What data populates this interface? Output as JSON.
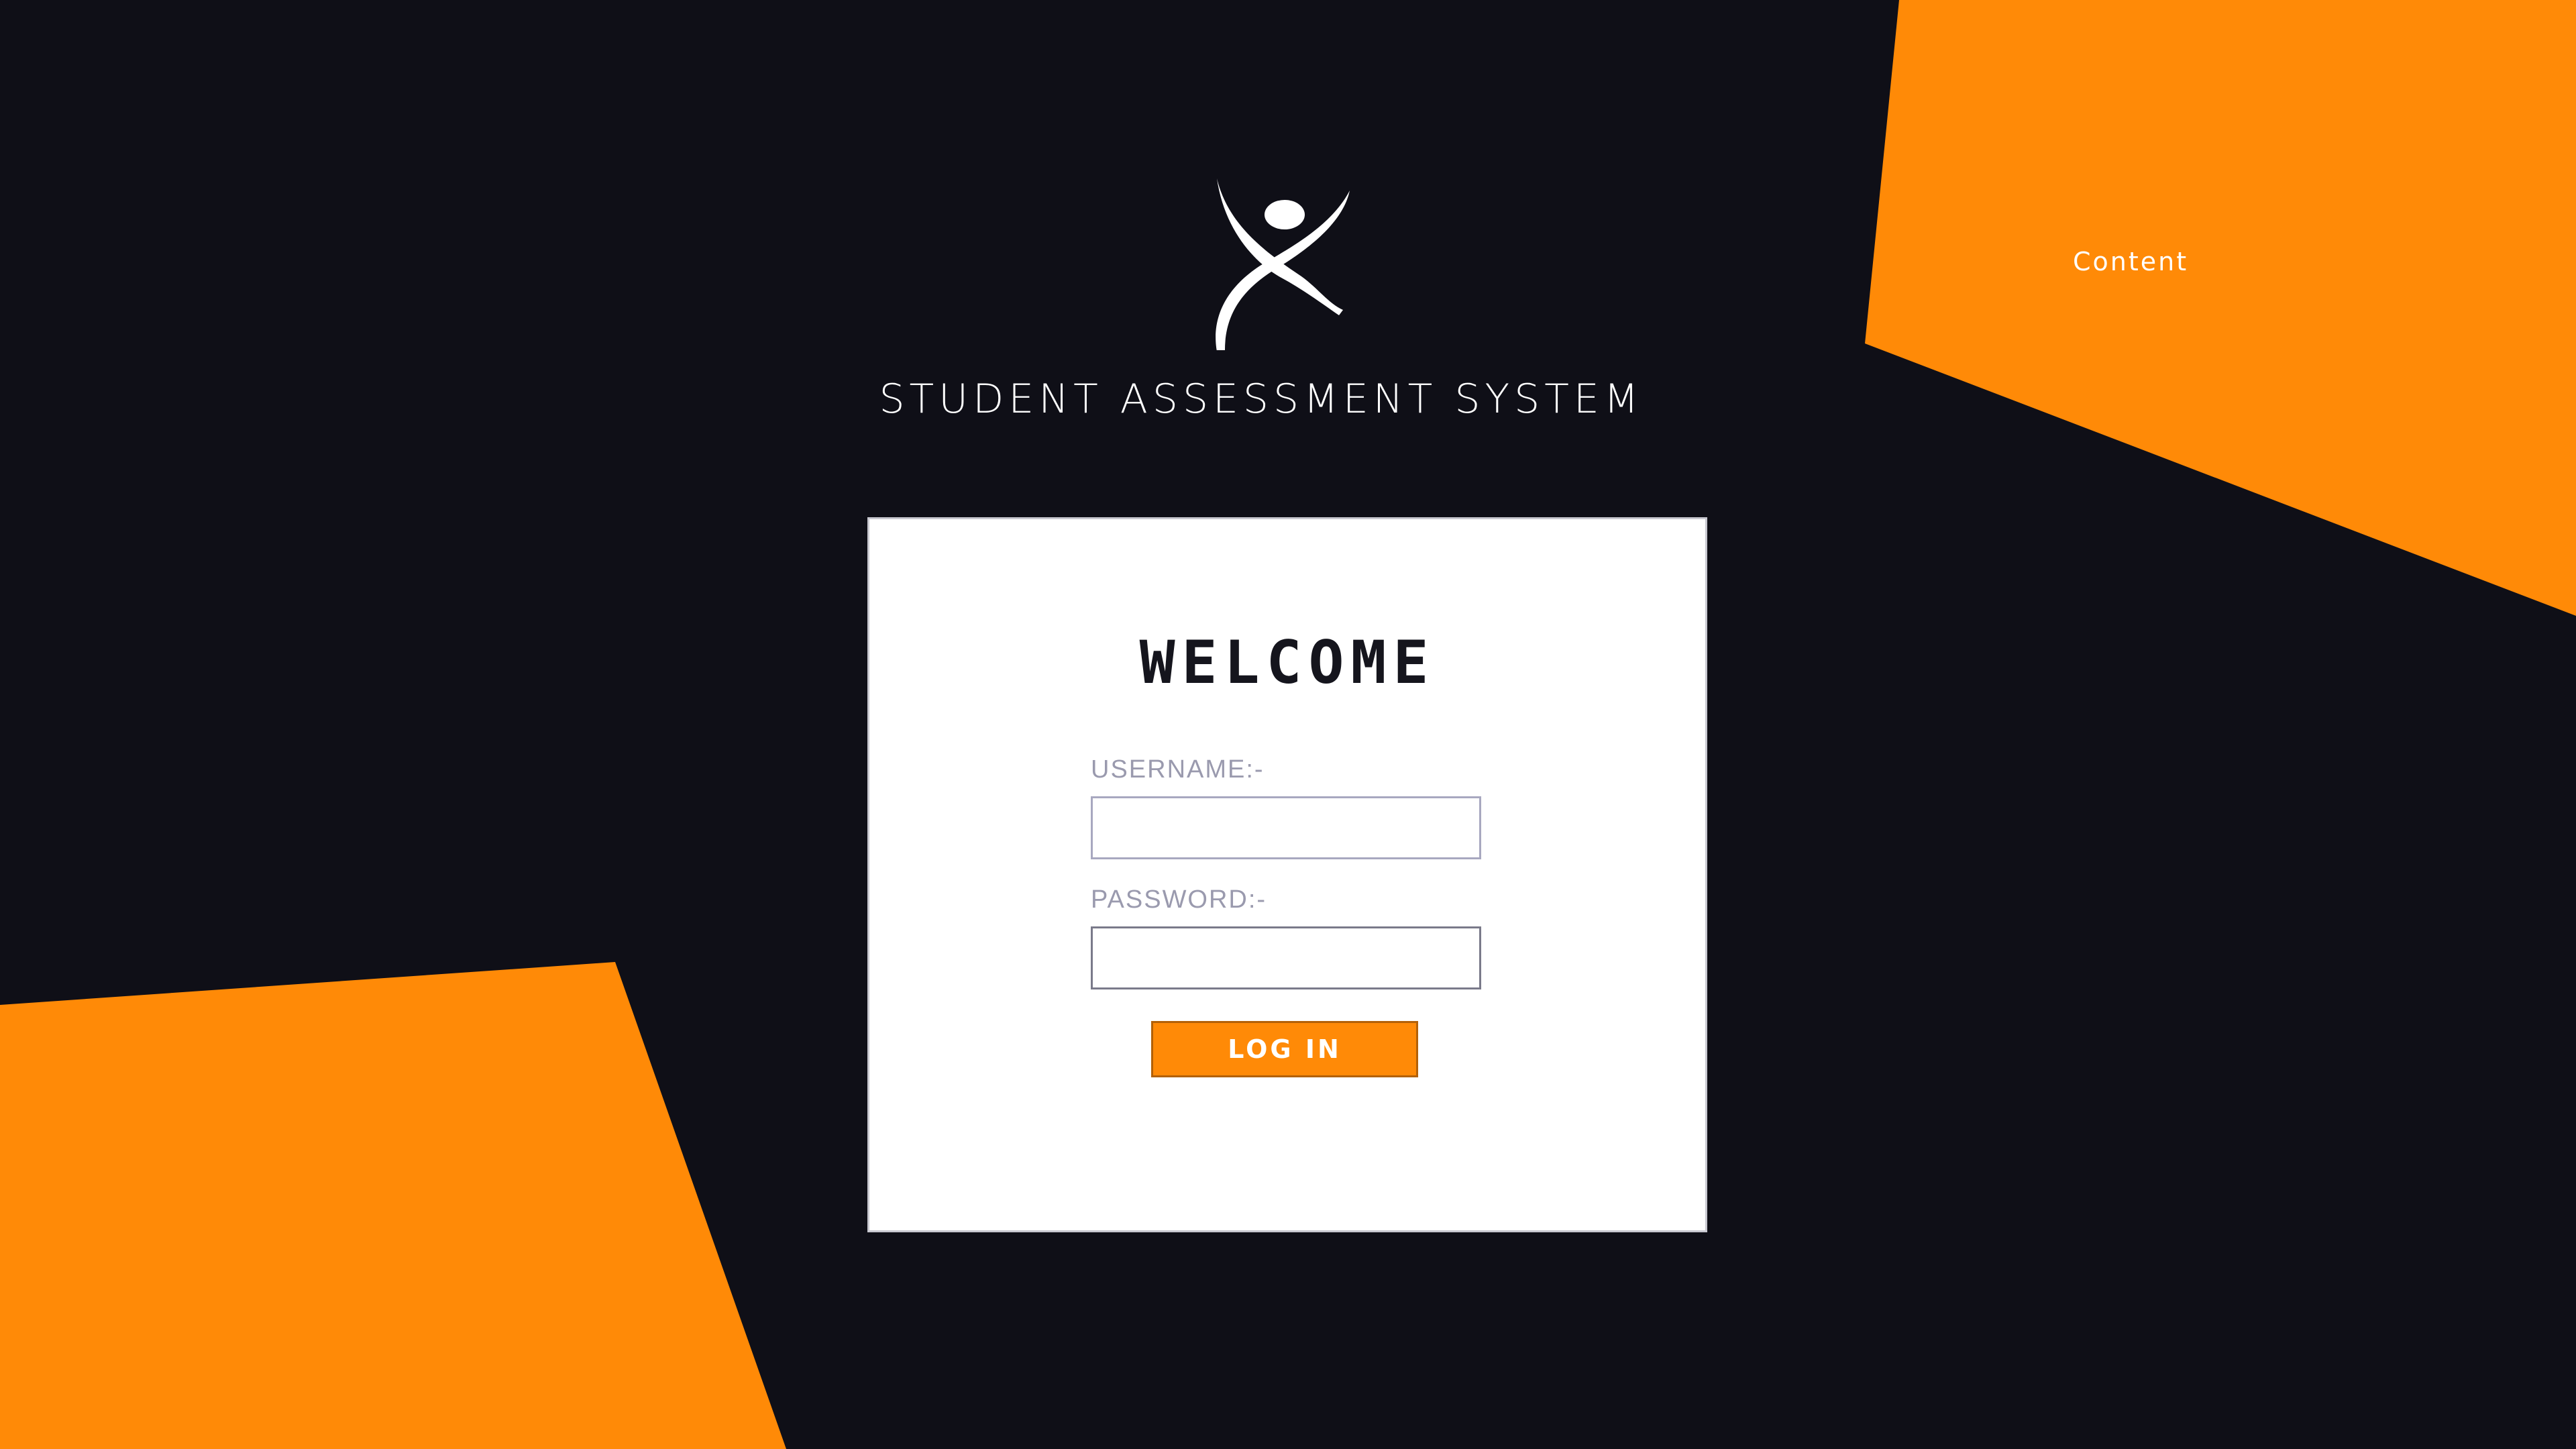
{
  "header": {
    "corner_link": "Content",
    "app_title": "STUDENT ASSESSMENT SYSTEM",
    "logo_icon": "person-jumping-logo-icon"
  },
  "login_card": {
    "heading": "WELCOME",
    "username_label": "USERNAME:-",
    "username_value": "",
    "password_label": "PASSWORD:-",
    "password_value": "",
    "login_button": "LOG IN"
  },
  "colors": {
    "background": "#0f0f17",
    "accent": "#ff8a07",
    "card": "#ffffff",
    "label": "#9a9aae"
  }
}
